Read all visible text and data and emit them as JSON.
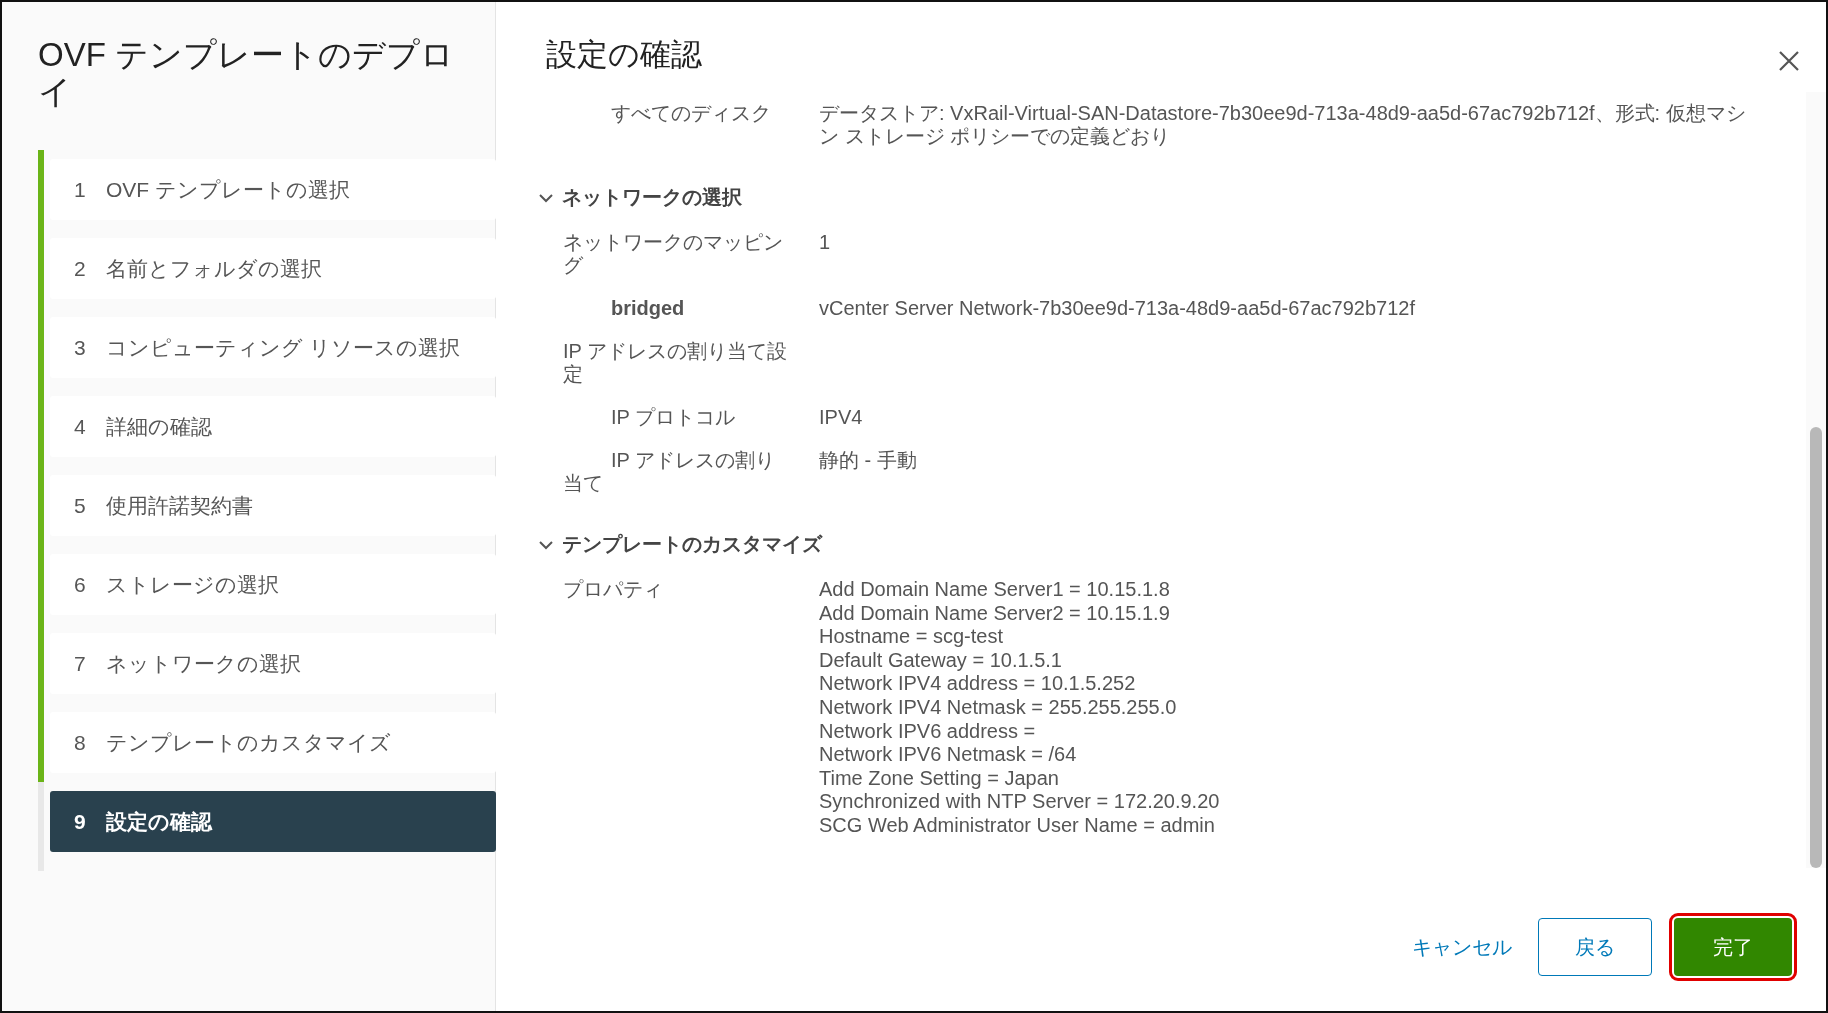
{
  "wizard": {
    "title": "OVF テンプレートのデプロイ",
    "steps": [
      {
        "number": "1",
        "label": "OVF テンプレートの選択",
        "selected": false,
        "completed": true
      },
      {
        "number": "2",
        "label": "名前とフォルダの選択",
        "selected": false,
        "completed": true
      },
      {
        "number": "3",
        "label": "コンピューティング リソースの選択",
        "selected": false,
        "completed": true
      },
      {
        "number": "4",
        "label": "詳細の確認",
        "selected": false,
        "completed": true
      },
      {
        "number": "5",
        "label": "使用許諾契約書",
        "selected": false,
        "completed": true
      },
      {
        "number": "6",
        "label": "ストレージの選択",
        "selected": false,
        "completed": true
      },
      {
        "number": "7",
        "label": "ネットワークの選択",
        "selected": false,
        "completed": true
      },
      {
        "number": "8",
        "label": "テンプレートのカスタマイズ",
        "selected": false,
        "completed": true
      },
      {
        "number": "9",
        "label": "設定の確認",
        "selected": true,
        "completed": false
      }
    ]
  },
  "page": {
    "title": "設定の確認",
    "sections": [
      {
        "rows": [
          {
            "children": [
              {
                "label": "すべてのディスク",
                "bold": false,
                "value": "データストア: VxRail-Virtual-SAN-Datastore-7b30ee9d-713a-48d9-aa5d-67ac792b712f、形式: 仮想マシン ストレージ ポリシーでの定義どおり"
              }
            ]
          }
        ]
      },
      {
        "title": "ネットワークの選択",
        "expanded": true,
        "rows": [
          {
            "label": "ネットワークのマッピング",
            "value": "1",
            "children": [
              {
                "label": "bridged",
                "value": "vCenter Server Network-7b30ee9d-713a-48d9-aa5d-67ac792b712f",
                "bold": true
              }
            ]
          },
          {
            "label": "IP アドレスの割り当て設定",
            "children": [
              {
                "label": "IP プロトコル",
                "value": "IPV4",
                "bold": false
              },
              {
                "label": "IP アドレスの割り当て",
                "value": "静的 - 手動",
                "bold": false
              }
            ]
          }
        ]
      },
      {
        "title": "テンプレートのカスタマイズ",
        "expanded": true,
        "rows": [
          {
            "label": "プロパティ",
            "lines": [
              "Add Domain Name Server1 = 10.15.1.8",
              "Add Domain Name Server2 = 10.15.1.9",
              "Hostname = scg-test",
              "Default Gateway = 10.1.5.1",
              "Network IPV4 address = 10.1.5.252",
              "Network IPV4 Netmask = 255.255.255.0",
              "Network IPV6 address =",
              "Network IPV6 Netmask = /64",
              "Time Zone Setting = Japan",
              "Synchronized with NTP Server = 172.20.9.20",
              "SCG Web Administrator User Name = admin"
            ]
          }
        ]
      }
    ]
  },
  "buttons": [
    {
      "label": "キャンセル",
      "kind": "link",
      "highlighted": false
    },
    {
      "label": "戻る",
      "kind": "outline",
      "highlighted": false
    },
    {
      "label": "完了",
      "kind": "primary",
      "highlighted": true
    }
  ]
}
